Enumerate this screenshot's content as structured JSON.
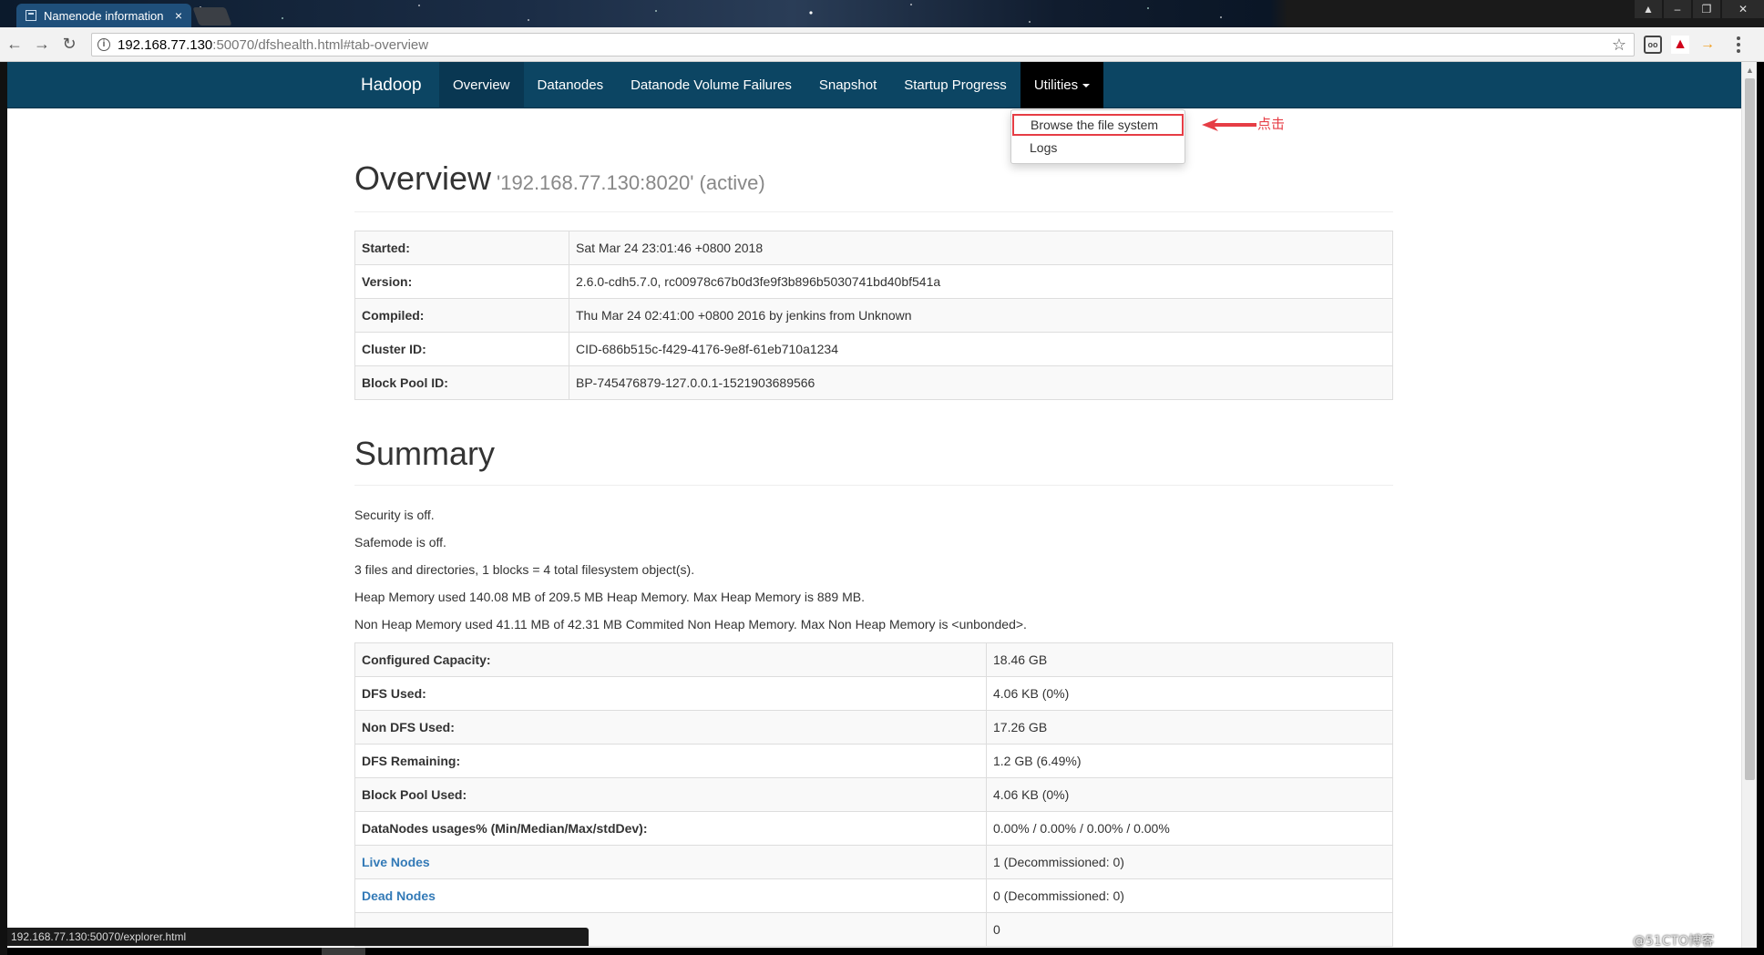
{
  "browser": {
    "tab_title": "Namenode information",
    "tab_close": "×",
    "url_host": "192.168.77.130",
    "url_rest": ":50070/dfshealth.html#tab-overview",
    "status_url": "192.168.77.130:50070/explorer.html",
    "window_controls": [
      "▲",
      "–",
      "❐",
      "✕"
    ]
  },
  "navbar": {
    "brand": "Hadoop",
    "items": [
      {
        "label": "Overview"
      },
      {
        "label": "Datanodes"
      },
      {
        "label": "Datanode Volume Failures"
      },
      {
        "label": "Snapshot"
      },
      {
        "label": "Startup Progress"
      },
      {
        "label": "Utilities"
      }
    ]
  },
  "dropdown": {
    "items": [
      {
        "label": "Browse the file system"
      },
      {
        "label": "Logs"
      }
    ]
  },
  "annotation": {
    "label": "点击",
    "color": "#e63d45"
  },
  "overview": {
    "title": "Overview",
    "subtitle": "'192.168.77.130:8020' (active)",
    "rows": [
      {
        "k": "Started:",
        "v": "Sat Mar 24 23:01:46 +0800 2018"
      },
      {
        "k": "Version:",
        "v": "2.6.0-cdh5.7.0, rc00978c67b0d3fe9f3b896b5030741bd40bf541a"
      },
      {
        "k": "Compiled:",
        "v": "Thu Mar 24 02:41:00 +0800 2016 by jenkins from Unknown"
      },
      {
        "k": "Cluster ID:",
        "v": "CID-686b515c-f429-4176-9e8f-61eb710a1234"
      },
      {
        "k": "Block Pool ID:",
        "v": "BP-745476879-127.0.0.1-1521903689566"
      }
    ]
  },
  "summary": {
    "title": "Summary",
    "lines": [
      "Security is off.",
      "Safemode is off.",
      "3 files and directories, 1 blocks = 4 total filesystem object(s).",
      "Heap Memory used 140.08 MB of 209.5 MB Heap Memory. Max Heap Memory is 889 MB.",
      "Non Heap Memory used 41.11 MB of 42.31 MB Commited Non Heap Memory. Max Non Heap Memory is <unbonded>."
    ],
    "rows": [
      {
        "k": "Configured Capacity:",
        "v": "18.46 GB"
      },
      {
        "k": "DFS Used:",
        "v": "4.06 KB (0%)"
      },
      {
        "k": "Non DFS Used:",
        "v": "17.26 GB"
      },
      {
        "k": "DFS Remaining:",
        "v": "1.2 GB (6.49%)"
      },
      {
        "k": "Block Pool Used:",
        "v": "4.06 KB (0%)"
      },
      {
        "k": "DataNodes usages% (Min/Median/Max/stdDev):",
        "v": "0.00% / 0.00% / 0.00% / 0.00%"
      },
      {
        "k": "Live Nodes",
        "v": "1 (Decommissioned: 0)",
        "link": true
      },
      {
        "k": "Dead Nodes",
        "v": "0 (Decommissioned: 0)",
        "link": true
      },
      {
        "k": "",
        "v": "0"
      }
    ]
  },
  "watermark": "@51CTO博客",
  "colors": {
    "navbar": "#0c4563",
    "link": "#337ab7",
    "highlight": "#e63d45"
  }
}
